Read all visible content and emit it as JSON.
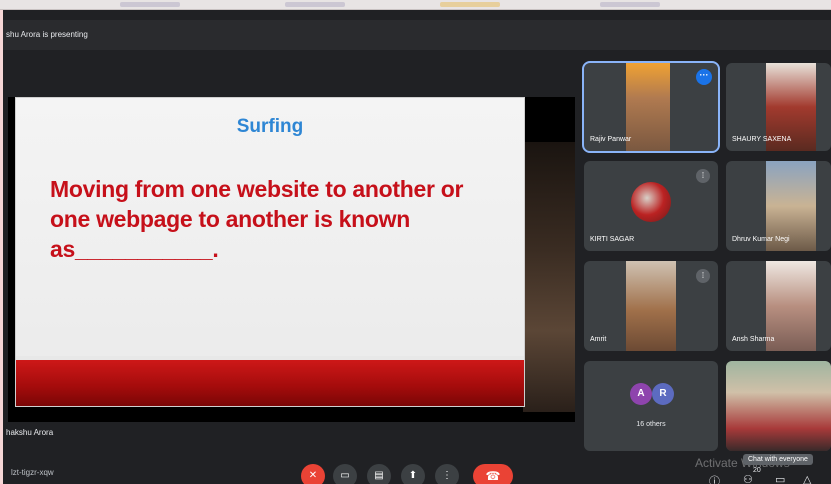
{
  "header": {
    "presenting_text": "shu Arora is presenting"
  },
  "slide": {
    "title": "Surfing",
    "body": "Moving from one website to another or one webpage to another is known as___________."
  },
  "presenter": {
    "name": "hakshu Arora"
  },
  "participants": [
    {
      "name": "Rajiv Panwar"
    },
    {
      "name": "SHAURY SAXENA"
    },
    {
      "name": "KIRTI SAGAR"
    },
    {
      "name": "Dhruv Kumar Negi"
    },
    {
      "name": "Amrit"
    },
    {
      "name": "Ansh Sharma"
    }
  ],
  "others": {
    "avatar_a": "A",
    "avatar_r": "R",
    "label": "16 others"
  },
  "bottom": {
    "meeting_code": "lzt-tigzr-xqw",
    "participant_count": "20",
    "chat_tooltip": "Chat with everyone",
    "watermark": "Activate Windows"
  }
}
